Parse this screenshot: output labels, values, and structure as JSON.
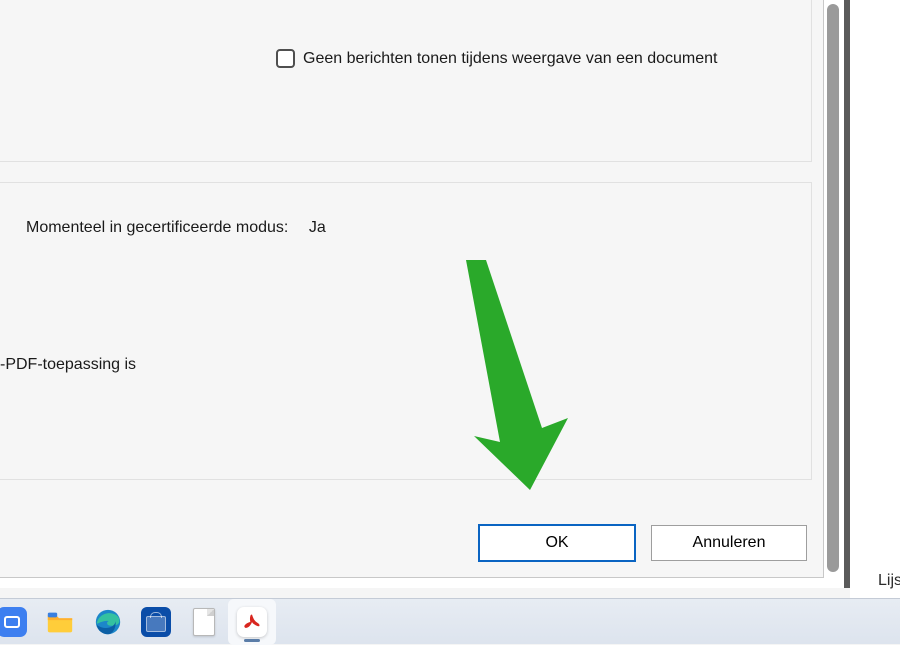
{
  "dialog": {
    "checkbox": {
      "label": "Geen berichten tonen tijdens weergave van een document",
      "checked": false
    },
    "status": {
      "label": "Momenteel in gecertificeerde modus:",
      "value": "Ja"
    },
    "partial_text": "-PDF-toepassing is",
    "buttons": {
      "ok": "OK",
      "cancel": "Annuleren"
    }
  },
  "desktop": {
    "partial_label": "Lijst"
  },
  "taskbar": {
    "items": [
      {
        "name": "zoom-icon"
      },
      {
        "name": "file-explorer-icon"
      },
      {
        "name": "edge-icon"
      },
      {
        "name": "microsoft-store-icon"
      },
      {
        "name": "document-icon"
      },
      {
        "name": "acrobat-icon",
        "active": true
      }
    ]
  },
  "annotation": {
    "arrow_color": "#2aa92a"
  }
}
